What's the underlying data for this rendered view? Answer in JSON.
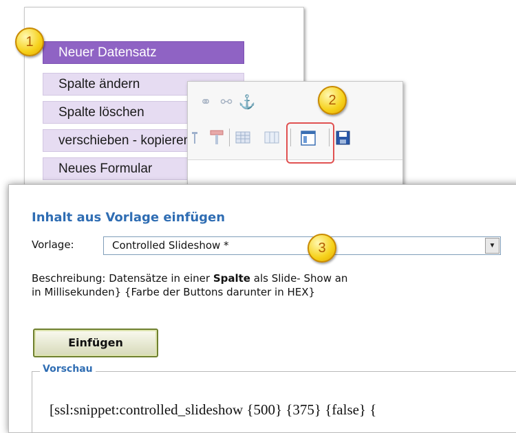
{
  "context_menu": {
    "items": [
      {
        "label": "Neuer Datensatz",
        "active": true
      },
      {
        "label": "Spalte ändern"
      },
      {
        "label": "Spalte löschen"
      },
      {
        "label": "verschieben - kopieren"
      },
      {
        "label": "Neues Formular"
      }
    ]
  },
  "toolbar": {
    "icons": [
      "link-icon",
      "unlink-icon",
      "anchor-icon",
      "cell-props-icon",
      "merge-icon",
      "table-icon",
      "table-props-icon",
      "template-icon",
      "save-icon"
    ],
    "glyphs": {
      "link": "⚭",
      "unlink": "⚯",
      "anchor": "⚓",
      "save": "▣"
    }
  },
  "callouts": [
    "1",
    "2",
    "3"
  ],
  "dialog": {
    "title": "Inhalt aus Vorlage einfügen",
    "template_label": "Vorlage:",
    "template_value": "Controlled Slideshow *",
    "description_prefix": "Beschreibung: Datensätze in einer ",
    "description_bold": "Spalte",
    "description_suffix": " als Slide- Show an",
    "description_line2": "in Millisekunden} {Farbe der Buttons darunter in HEX}",
    "insert_label": "Einfügen",
    "preview_legend": "Vorschau",
    "preview_text": "[ssl:snippet:controlled_slideshow {500} {375} {false} {"
  },
  "colors": {
    "menu_active": "#8f63c4",
    "menu_item": "#e6dcf2",
    "title_blue": "#2f6db3",
    "callout_yellow": "#f6d11a",
    "highlight_red": "#e05050"
  }
}
